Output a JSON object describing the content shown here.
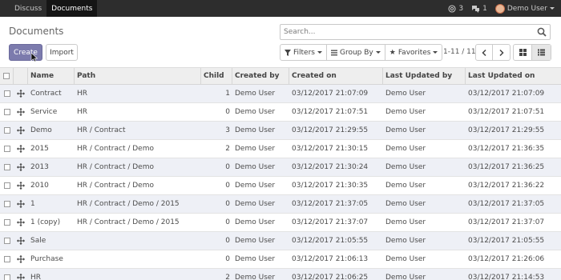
{
  "topbar": {
    "menu": [
      {
        "label": "Discuss",
        "active": false
      },
      {
        "label": "Documents",
        "active": true
      }
    ],
    "activity_count": "3",
    "messages_count": "1",
    "user_name": "Demo User"
  },
  "page_title": "Documents",
  "search": {
    "placeholder": "Search..."
  },
  "buttons": {
    "create": "Create",
    "import": "Import"
  },
  "toolbar": {
    "filters": "Filters",
    "group_by": "Group By",
    "favorites": "Favorites"
  },
  "pager": {
    "text": "1-11 / 11"
  },
  "table": {
    "columns": {
      "name": "Name",
      "path": "Path",
      "child": "Child",
      "created_by": "Created by",
      "created_on": "Created on",
      "last_updated_by": "Last Updated by",
      "last_updated_on": "Last Updated on"
    },
    "rows": [
      {
        "name": "Contract",
        "path": "HR",
        "child": "1",
        "created_by": "Demo User",
        "created_on": "03/12/2017 21:07:09",
        "updated_by": "Demo User",
        "updated_on": "03/12/2017 21:07:09"
      },
      {
        "name": "Service",
        "path": "HR",
        "child": "0",
        "created_by": "Demo User",
        "created_on": "03/12/2017 21:07:51",
        "updated_by": "Demo User",
        "updated_on": "03/12/2017 21:07:51"
      },
      {
        "name": "Demo",
        "path": "HR / Contract",
        "child": "3",
        "created_by": "Demo User",
        "created_on": "03/12/2017 21:29:55",
        "updated_by": "Demo User",
        "updated_on": "03/12/2017 21:29:55"
      },
      {
        "name": "2015",
        "path": "HR / Contract / Demo",
        "child": "2",
        "created_by": "Demo User",
        "created_on": "03/12/2017 21:30:15",
        "updated_by": "Demo User",
        "updated_on": "03/12/2017 21:36:35"
      },
      {
        "name": "2013",
        "path": "HR / Contract / Demo",
        "child": "0",
        "created_by": "Demo User",
        "created_on": "03/12/2017 21:30:24",
        "updated_by": "Demo User",
        "updated_on": "03/12/2017 21:36:25"
      },
      {
        "name": "2010",
        "path": "HR / Contract / Demo",
        "child": "0",
        "created_by": "Demo User",
        "created_on": "03/12/2017 21:30:35",
        "updated_by": "Demo User",
        "updated_on": "03/12/2017 21:36:22"
      },
      {
        "name": "1",
        "path": "HR / Contract / Demo / 2015",
        "child": "0",
        "created_by": "Demo User",
        "created_on": "03/12/2017 21:37:05",
        "updated_by": "Demo User",
        "updated_on": "03/12/2017 21:37:05"
      },
      {
        "name": "1 (copy)",
        "path": "HR / Contract / Demo / 2015",
        "child": "0",
        "created_by": "Demo User",
        "created_on": "03/12/2017 21:37:07",
        "updated_by": "Demo User",
        "updated_on": "03/12/2017 21:37:07"
      },
      {
        "name": "Sale",
        "path": "",
        "child": "0",
        "created_by": "Demo User",
        "created_on": "03/12/2017 21:05:55",
        "updated_by": "Demo User",
        "updated_on": "03/12/2017 21:05:55"
      },
      {
        "name": "Purchase",
        "path": "",
        "child": "0",
        "created_by": "Demo User",
        "created_on": "03/12/2017 21:06:13",
        "updated_by": "Demo User",
        "updated_on": "03/12/2017 21:26:06"
      },
      {
        "name": "HR",
        "path": "",
        "child": "2",
        "created_by": "Demo User",
        "created_on": "03/12/2017 21:06:25",
        "updated_by": "Demo User",
        "updated_on": "03/12/2017 21:14:53"
      }
    ]
  },
  "colors": {
    "topbar": "#2d2d2d",
    "primary": "#7c7bad",
    "row_alt": "#eef0f6"
  },
  "icons": [
    "bell-icon",
    "comments-icon",
    "search-icon",
    "filter-icon",
    "list-icon",
    "star-icon",
    "chevron-left-icon",
    "chevron-right-icon",
    "kanban-view-icon",
    "list-view-icon",
    "drag-handle-icon"
  ]
}
